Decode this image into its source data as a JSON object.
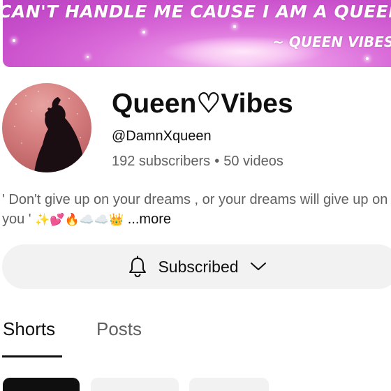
{
  "banner": {
    "line1": "CAN'T HANDLE ME CAUSE I AM A QUEEN",
    "line2": "~ QUEEN VIBES"
  },
  "channel": {
    "name": "Queen♡Vibes",
    "handle": "@DamnXqueen",
    "subscribers": "192 subscribers",
    "separator": "•",
    "videos": "50 videos"
  },
  "description": {
    "line1": "' Don't give up on your dreams , or your dreams will give up on",
    "line2_prefix": "you '",
    "emojis": "✨💕🔥☁️☁️👑",
    "more": "...more"
  },
  "subscribe_button": {
    "label": "Subscribed",
    "icon": "bell-icon",
    "dropdown_icon": "chevron-down-icon"
  },
  "tabs": [
    {
      "label": "Shorts",
      "selected": true
    },
    {
      "label": "Posts",
      "selected": false
    }
  ],
  "colors": {
    "banner_pink": "#d96ad8",
    "text_primary": "#0f0f0f",
    "text_secondary": "#606060",
    "button_bg": "#f2f2f2"
  }
}
